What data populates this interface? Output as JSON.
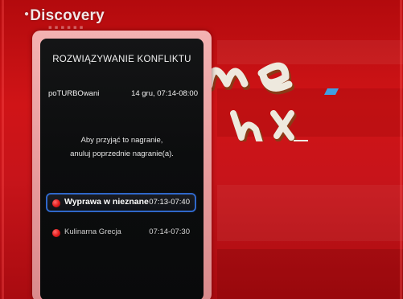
{
  "channel_logo": {
    "text": "Discovery"
  },
  "dialog": {
    "title": "ROZWIĄZYWANIE KONFLIKTU",
    "channel": "poTURBOwani",
    "datetime": "14 gru, 07:14-08:00",
    "message_line1": "Aby przyjąć to nagranie,",
    "message_line2": "anuluj poprzednie nagranie(a).",
    "recordings": [
      {
        "title": "Wyprawa w nieznane",
        "time": "07:13-07:40",
        "selected": true
      },
      {
        "title": "Kulinarna Grecja",
        "time": "07:14-07:30",
        "selected": false
      }
    ]
  },
  "colors": {
    "background_red": "#c7141a",
    "frame_pink": "#e79a9b",
    "panel_black": "#0c0d0e",
    "selection_blue": "#2f67c9",
    "record_dot_red": "#e31b1b"
  },
  "icons": {
    "record": "record-dot-icon",
    "logo_globe": "globe-icon"
  }
}
